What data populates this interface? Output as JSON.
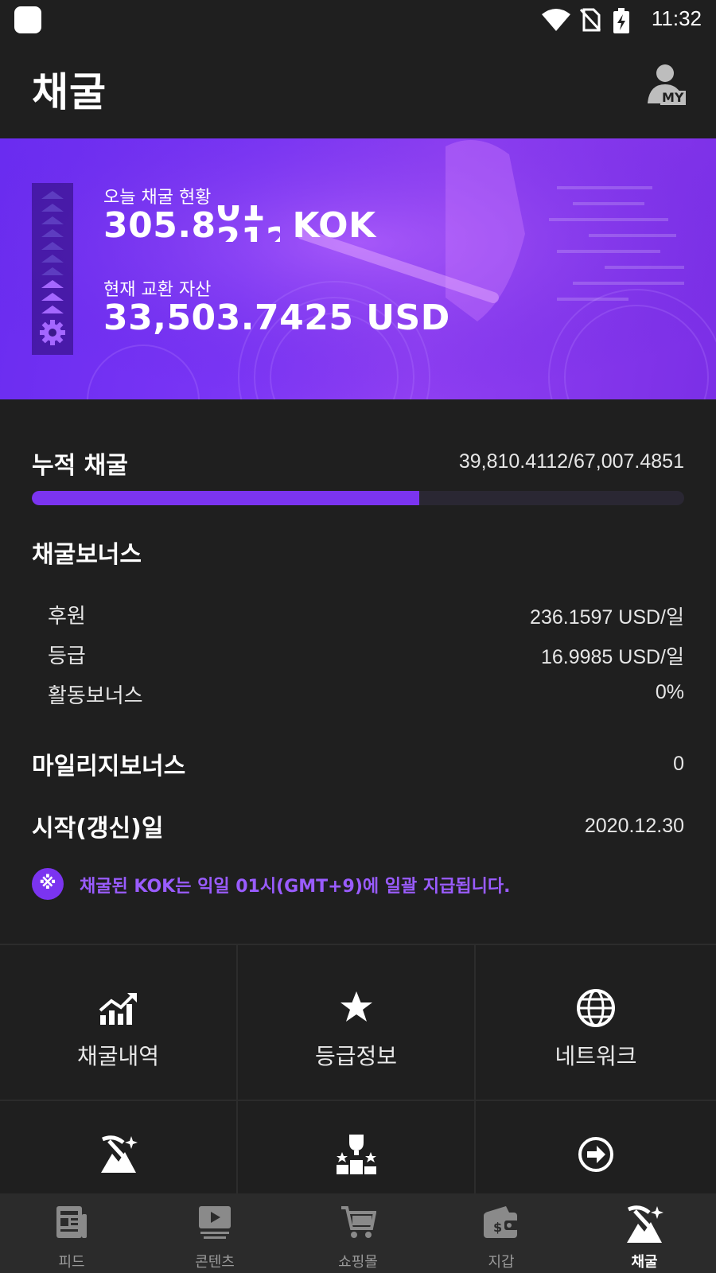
{
  "status_bar": {
    "time": "11:32"
  },
  "header": {
    "title": "채굴",
    "my_label": "MY"
  },
  "banner": {
    "today_label": "오늘 채굴 현황",
    "today_value_prefix": "305.8",
    "today_value_roll_top": "01",
    "today_value_roll_bottom": "212",
    "today_unit": "KOK",
    "asset_label": "현재 교환 자산",
    "asset_value": "33,503.7425 USD"
  },
  "cumulative": {
    "label": "누적 채굴",
    "value": "39,810.4112/67,007.4851",
    "progress": 0.594
  },
  "bonus": {
    "title": "채굴보너스",
    "items": [
      {
        "label": "후원",
        "value": "236.1597 USD/일"
      },
      {
        "label": "등급",
        "value": "16.9985 USD/일"
      },
      {
        "label": "활동보너스",
        "value": "0%"
      }
    ]
  },
  "mileage": {
    "label": "마일리지보너스",
    "value": "0"
  },
  "start_date": {
    "label": "시작(갱신)일",
    "value": "2020.12.30"
  },
  "notice": {
    "symbol": "※",
    "text": "채굴된 KOK는 익일 01시(GMT+9)에 일괄 지급됩니다."
  },
  "menu": [
    {
      "label": "채굴내역",
      "icon": "chart-growth-icon"
    },
    {
      "label": "등급정보",
      "icon": "star-icon"
    },
    {
      "label": "네트워크",
      "icon": "globe-icon"
    },
    {
      "label": "",
      "icon": "mining-icon"
    },
    {
      "label": "",
      "icon": "trophy-podium-icon"
    },
    {
      "label": "",
      "icon": "arrow-circle-icon"
    }
  ],
  "bottom_nav": [
    {
      "label": "피드",
      "icon": "newspaper-icon"
    },
    {
      "label": "콘텐츠",
      "icon": "video-icon"
    },
    {
      "label": "쇼핑몰",
      "icon": "cart-icon"
    },
    {
      "label": "지갑",
      "icon": "wallet-icon"
    },
    {
      "label": "채굴",
      "icon": "mining-icon",
      "active": true
    }
  ],
  "colors": {
    "accent": "#7b34f0",
    "accent_text": "#9a5cff",
    "background": "#1f1f1f",
    "nav_bg": "#2b2b2b"
  }
}
